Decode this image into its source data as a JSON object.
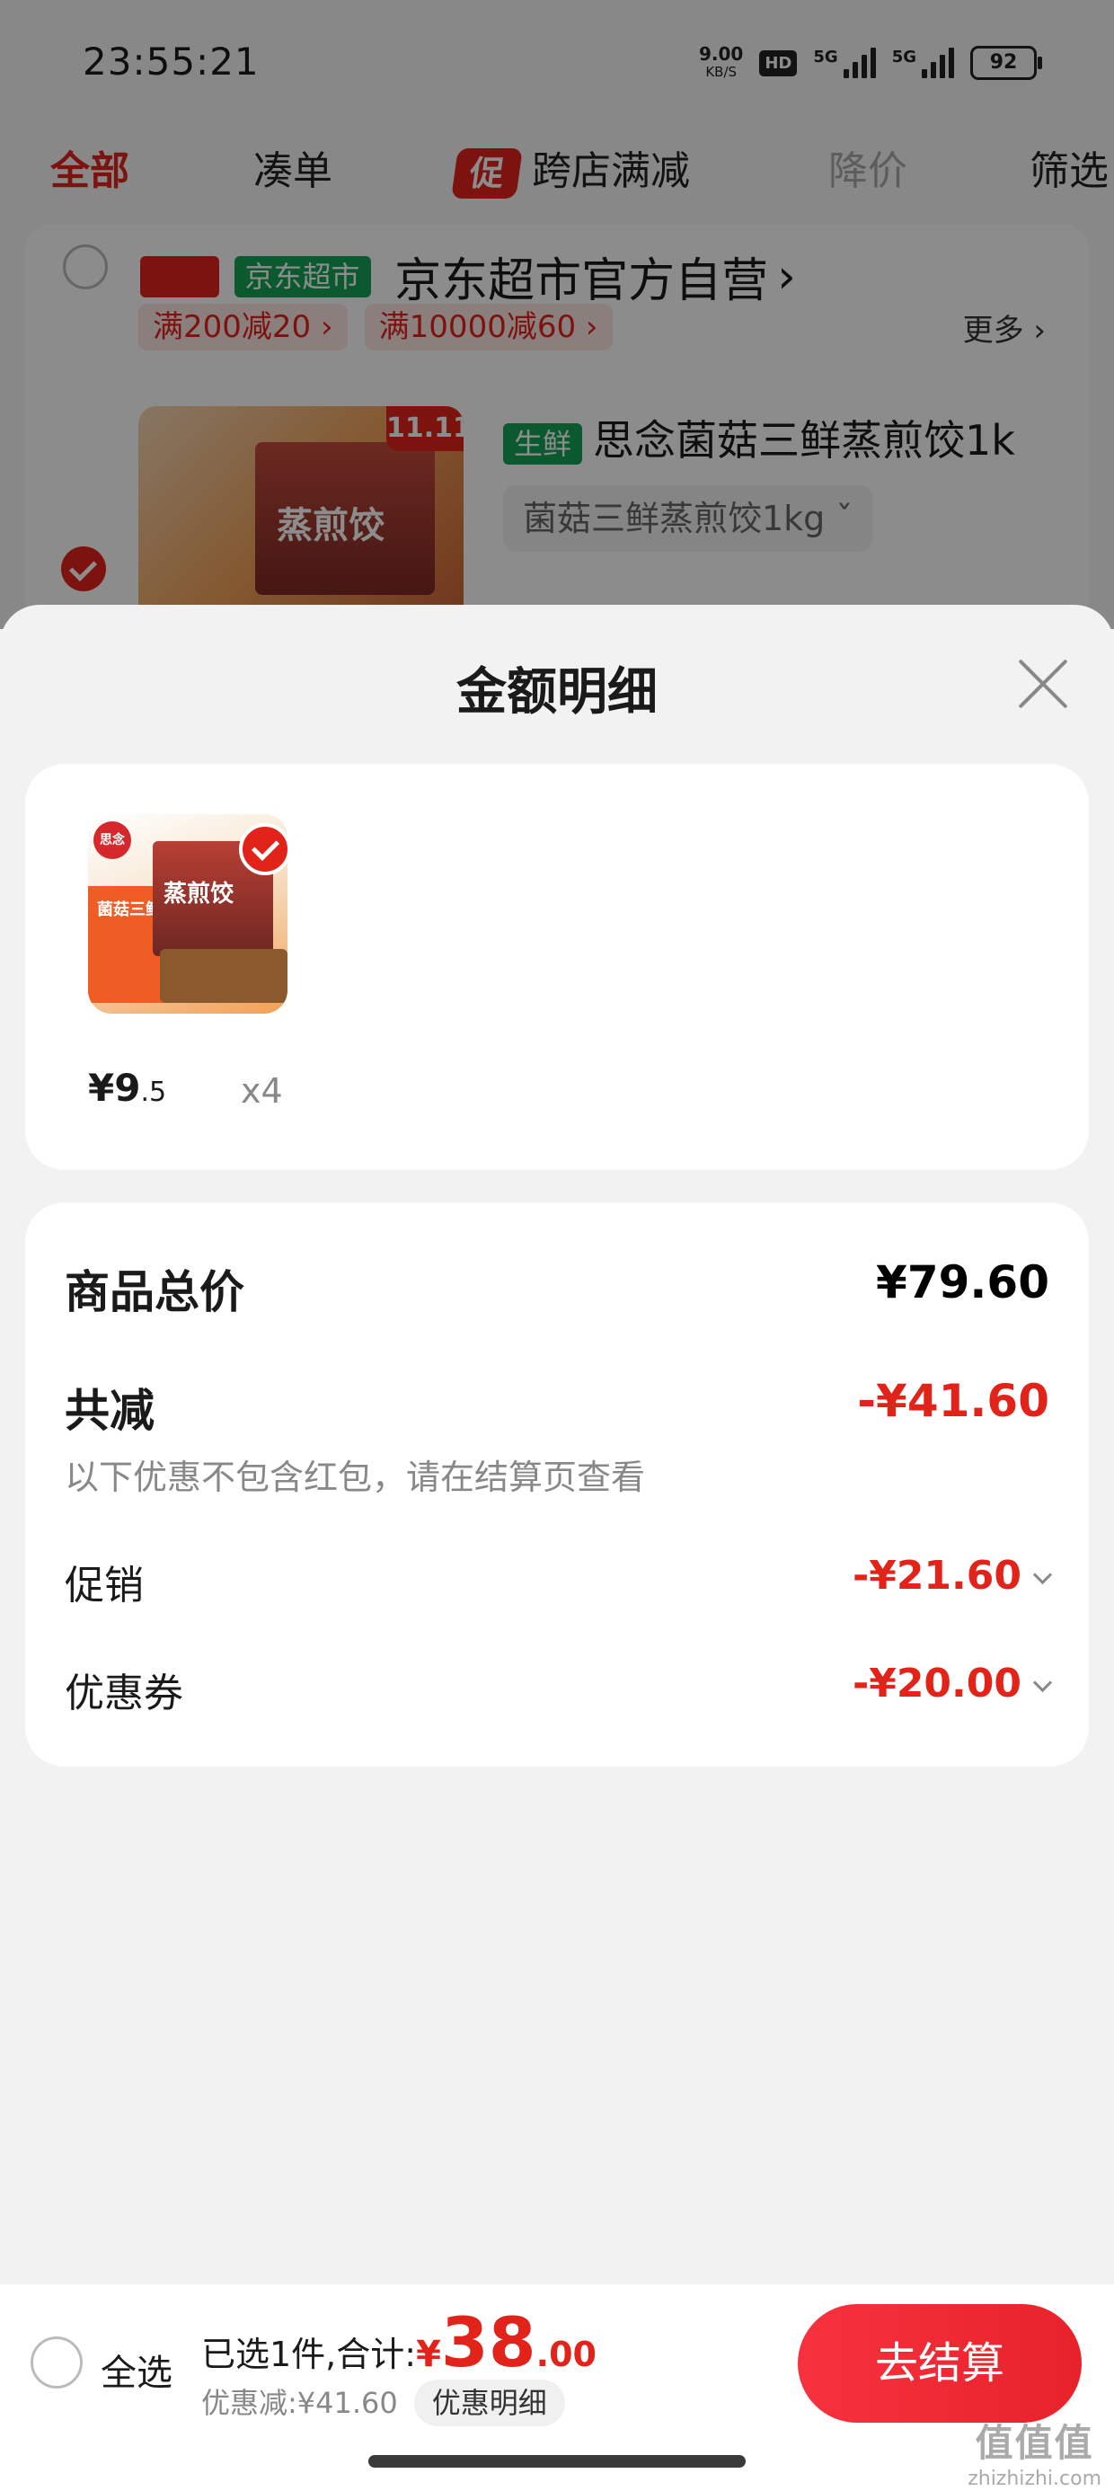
{
  "status_bar": {
    "time": "23:55:21",
    "net_speed": "9.00",
    "net_unit": "KB/S",
    "hd": "HD",
    "signal1": "5G",
    "signal2": "5G",
    "battery": "92"
  },
  "tabs": [
    {
      "label": "全部"
    },
    {
      "label": "凑单"
    },
    {
      "label": "跨店满减",
      "icon_label": "促"
    },
    {
      "label": "降价"
    },
    {
      "label": "筛选"
    }
  ],
  "store": {
    "tag_self": "自营",
    "tag_market": "京东超市",
    "name": "京东超市官方自营",
    "coupons": [
      "满200减20 ›",
      "满10000减60 ›"
    ],
    "more": "更多 ›",
    "product_title": "思念菌菇三鲜蒸煎饺1k",
    "fresh_tag": "生鲜",
    "spec": "菌菇三鲜蒸煎饺1kg ˇ",
    "badge": "11.11"
  },
  "sheet": {
    "title": "金额明细"
  },
  "item": {
    "price_int": "¥9",
    "price_dec": ".5",
    "qty": "x4"
  },
  "summary": {
    "total_label": "商品总价",
    "total_value": "¥79.60",
    "discount_label": "共减",
    "discount_value": "-¥41.60",
    "note": "以下优惠不包含红包，请在结算页查看",
    "promo_label": "促销",
    "promo_value": "-¥21.60",
    "coupon_label": "优惠券",
    "coupon_value": "-¥20.00"
  },
  "bottom": {
    "select_all": "全选",
    "selected_text": "已选1件,合计:",
    "currency": "¥",
    "amount_int": "38",
    "amount_dec": ".00",
    "discount_text": "优惠减:¥41.60",
    "detail_label": "优惠明细",
    "checkout_label": "去结算"
  },
  "watermark": {
    "logo": "值值值",
    "site": "zhizhizhi.com"
  },
  "colors": {
    "accent": "#e2231a",
    "market_green": "#15a356"
  }
}
